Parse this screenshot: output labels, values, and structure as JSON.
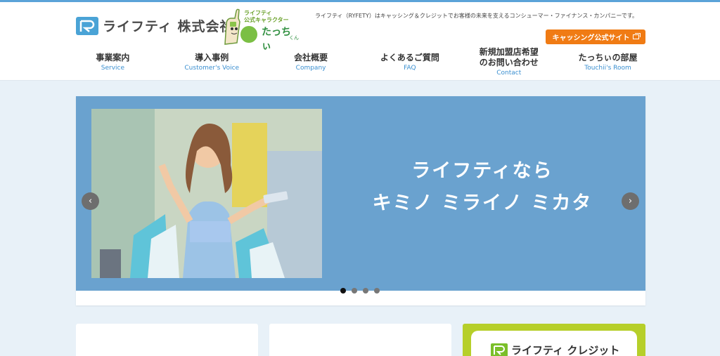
{
  "header": {
    "logo_text": "ライフティ 株式会社",
    "mascot_caption_line1": "ライフティ",
    "mascot_caption_line2": "公式キャラクター",
    "mascot_name": "たっちぃ",
    "mascot_suffix": "くん",
    "tagline": "ライフティ（RYFETY）はキャッシング＆クレジットでお客様の未来を支えるコンシューマー・ファイナンス・カンパニーです。",
    "cta_label": "キャッシング公式サイト"
  },
  "nav": [
    {
      "jp": "事業案内",
      "en": "Service"
    },
    {
      "jp": "導入事例",
      "en": "Customer's Voice"
    },
    {
      "jp": "会社概要",
      "en": "Company"
    },
    {
      "jp": "よくあるご質問",
      "en": "FAQ"
    },
    {
      "jp": "新規加盟店希望\nのお問い合わせ",
      "en": "Contact"
    },
    {
      "jp": "たっちぃの部屋",
      "en": "Touchii's Room"
    }
  ],
  "hero": {
    "line1": "ライフティなら",
    "line2": "キミノ ミライノ ミカタ",
    "arrow_prev": "‹",
    "arrow_next": "›",
    "dot_count": 4,
    "active_dot": 0
  },
  "cards": {
    "card3_label": "ライフティ クレジット"
  },
  "colors": {
    "accent_blue": "#5ba3d8",
    "slide_bg": "#6aa2cf",
    "cta_orange": "#f07b14",
    "card_green": "#b6cf2a"
  }
}
